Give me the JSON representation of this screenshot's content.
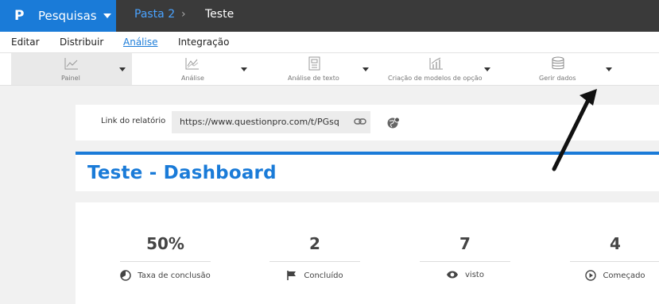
{
  "app": {
    "logo_glyph": "P",
    "name": "Pesquisas",
    "brand_color": "#1a7bd8"
  },
  "breadcrumb": {
    "folder": "Pasta 2",
    "separator": "›",
    "current": "Teste"
  },
  "menu": {
    "items": [
      {
        "label": "Editar"
      },
      {
        "label": "Distribuir"
      },
      {
        "label": "Análise",
        "active": true
      },
      {
        "label": "Integração"
      }
    ]
  },
  "toolbar": {
    "items": [
      {
        "label": "Painel",
        "icon": "line-chart-icon",
        "active": true
      },
      {
        "label": "Análise",
        "icon": "trend-chart-icon"
      },
      {
        "label": "Análise de texto",
        "icon": "text-analysis-icon"
      },
      {
        "label": "Criação de modelos de opção",
        "icon": "bar-chart-icon"
      },
      {
        "label": "Gerir dados",
        "icon": "database-icon"
      }
    ]
  },
  "report_link": {
    "label": "Link do relatório",
    "url": "https://www.questionpro.com/t/PGsq"
  },
  "dashboard": {
    "title": "Teste - Dashboard"
  },
  "stats": [
    {
      "value": "50%",
      "label": "Taxa de conclusão",
      "icon": "pie-icon"
    },
    {
      "value": "2",
      "label": "Concluído",
      "icon": "flag-icon"
    },
    {
      "value": "7",
      "label": "visto",
      "icon": "eye-icon"
    },
    {
      "value": "4",
      "label": "Começado",
      "icon": "play-icon"
    }
  ]
}
